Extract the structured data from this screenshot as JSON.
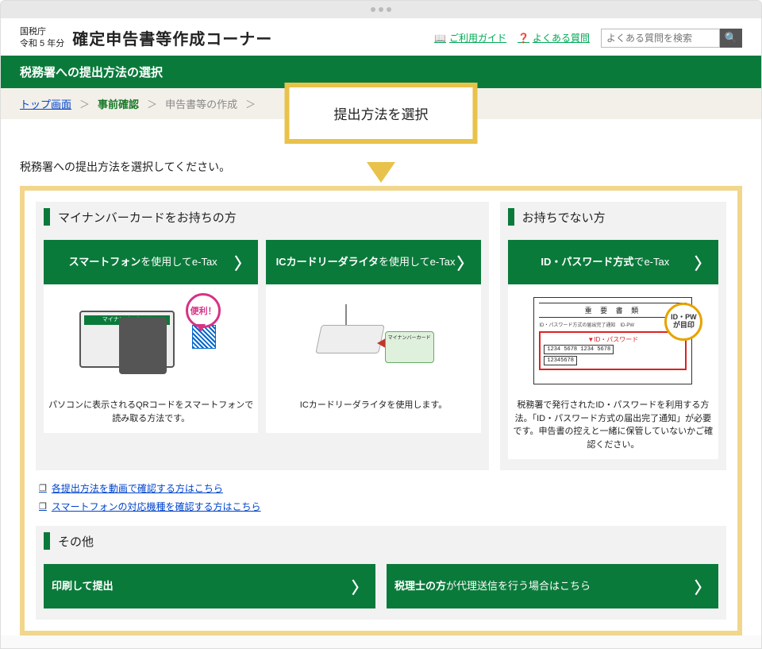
{
  "header": {
    "agency_line1": "国税庁",
    "agency_line2": "令和 5 年分",
    "app_title": "確定申告書等作成コーナー",
    "guide_link": "ご利用ガイド",
    "faq_link": "よくある質問",
    "search_placeholder": "よくある質問を検索"
  },
  "page_title": "税務署への提出方法の選択",
  "breadcrumb": {
    "top": "トップ画面",
    "current": "事前確認",
    "next": "申告書等の作成",
    "sep": "＞"
  },
  "callout": "提出方法を選択",
  "instruction": "税務署への提出方法を選択してください。",
  "sections": {
    "has_card": "マイナンバーカードをお持ちの方",
    "no_card": "お持ちでない方",
    "other": "その他"
  },
  "options": {
    "smartphone": {
      "bold": "スマートフォン",
      "rest": "を使用してe-Tax"
    },
    "ic_reader": {
      "bold": "ICカードリーダライタ",
      "rest": "を使用してe-Tax"
    },
    "id_pw": {
      "bold": "ID・パスワード方式",
      "rest": "でe-Tax"
    },
    "print": {
      "bold": "印刷して提出",
      "rest": ""
    },
    "zeirishi": {
      "bold": "税理士の方",
      "rest": "が代理送信を行う場合はこちら"
    }
  },
  "descs": {
    "smartphone": "パソコンに表示されるQRコードをスマートフォンで読み取る方法です。",
    "ic_reader": "ICカードリーダライタを使用します。",
    "id_pw": "税務署で発行されたID・パスワードを利用する方法。「ID・パスワード方式の届出完了通知」が必要です。申告書の控えと一緒に保管していないかご確認ください。"
  },
  "illus": {
    "convenient": "便利！",
    "mynumber": "マイナンバーカード",
    "doc_title": "重 要 書 類",
    "doc_sub": "ID・パスワード方式の届出完了通知　ID-PW",
    "doc_red": "▼ID・パスワード",
    "doc_digits1": "1234 5678 1234 5678",
    "doc_digits2": "12345678",
    "stamp_l1": "ID・PW",
    "stamp_l2": "が目印"
  },
  "links": {
    "video": "各提出方法を動画で確認する方はこちら",
    "phones": "スマートフォンの対応機種を確認する方はこちら"
  }
}
